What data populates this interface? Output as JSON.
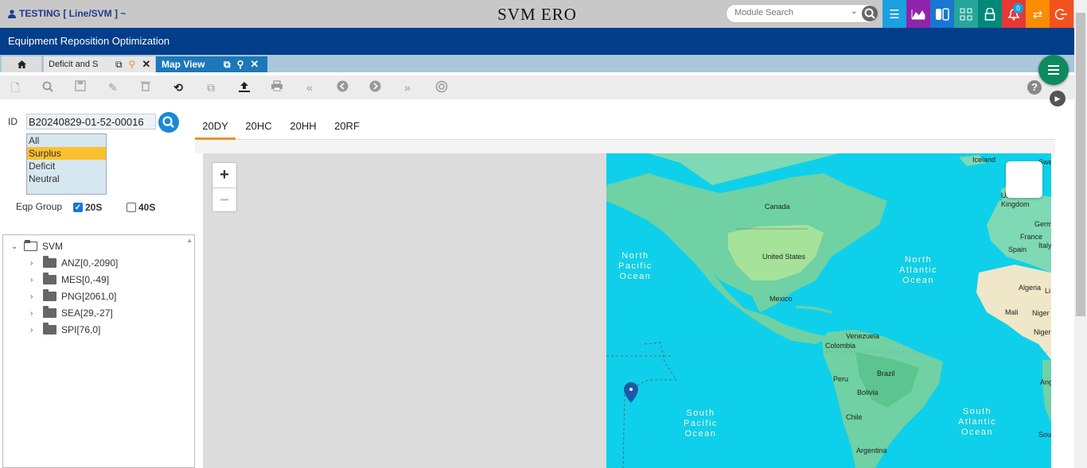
{
  "topbar": {
    "user_label": "TESTING [ Line/SVM ] ~",
    "app_title": "SVM ERO",
    "module_search_placeholder": "Module Search",
    "notification_count": "0",
    "colors": {
      "menu": "#1ba1e2",
      "chart": "#8e24aa",
      "switch": "#1976d2",
      "grid": "#26a69a",
      "lock": "#00897b",
      "bell": "#e53935",
      "swap": "#fb8c00",
      "logout": "#f4511e"
    }
  },
  "header": {
    "title": "Equipment Reposition Optimization"
  },
  "tabs": [
    {
      "label": "Deficit and S"
    },
    {
      "label": "Map View"
    }
  ],
  "form": {
    "id_label": "ID",
    "id_value": "B20240829-01-52-00016",
    "status_options": [
      "All",
      "Surplus",
      "Deficit",
      "Neutral"
    ],
    "selected_status": "Surplus",
    "eqp_group_label": "Eqp Group",
    "eqp_20s": "20S",
    "eqp_40s": "40S"
  },
  "tree": {
    "root": "SVM",
    "children": [
      "ANZ[0,-2090]",
      "MES[0,-49]",
      "PNG[2061,0]",
      "SEA[29,-27]",
      "SPI[76,0]"
    ]
  },
  "map_tabs": [
    "20DY",
    "20HC",
    "20HH",
    "20RF"
  ],
  "map": {
    "zoom_in": "+",
    "zoom_out": "−",
    "labels": {
      "iceland": "Iceland",
      "canada": "Canada",
      "united_states": "United States",
      "mexico": "Mexico",
      "venezuela": "Venezuela",
      "colombia": "Colombia",
      "brazil": "Brazil",
      "peru": "Peru",
      "bolivia": "Bolivia",
      "chile": "Chile",
      "argentina": "Argentina",
      "united_kingdom": "United\nKingdom",
      "germany": "Germany",
      "france": "France",
      "spain": "Spain",
      "italy": "Italy",
      "algeria": "Algeria",
      "mali": "Mali",
      "niger": "Niger",
      "nigeria": "Nigeria",
      "swe": "Swe",
      "li": "Li",
      "ang": "Ang",
      "sou": "Sou",
      "north_pacific": "North\nPacific\nOcean",
      "north_atlantic": "North\nAtlantic\nOcean",
      "south_pacific": "South\nPacific\nOcean",
      "south_atlantic": "South\nAtlantic\nOcean"
    }
  }
}
